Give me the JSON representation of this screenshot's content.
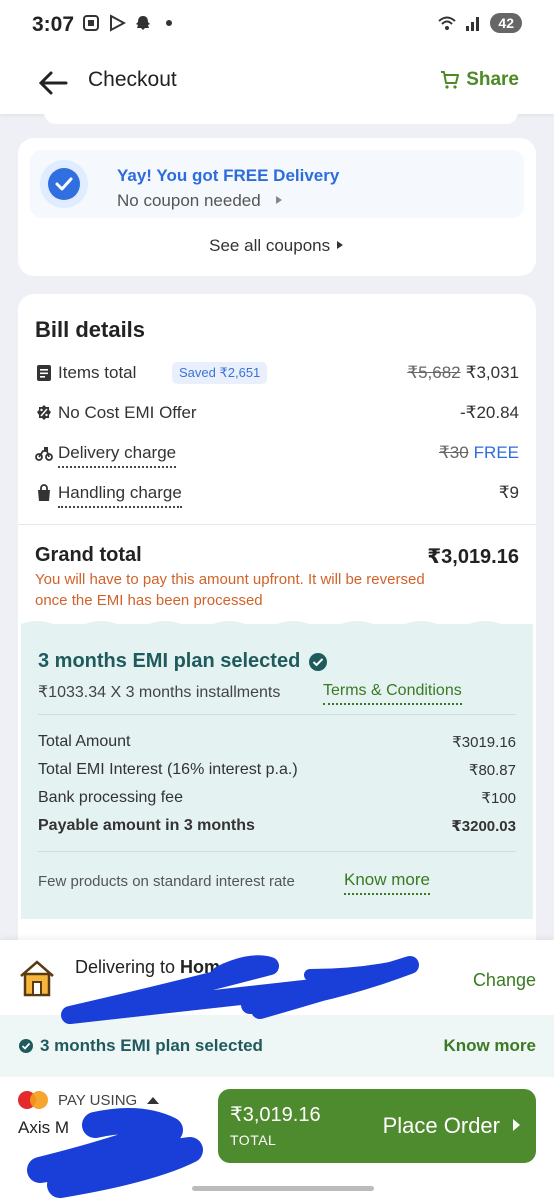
{
  "status": {
    "time": "3:07",
    "battery": "42"
  },
  "header": {
    "title": "Checkout",
    "share_label": "Share"
  },
  "coupon": {
    "title": "Yay! You got FREE Delivery",
    "subtitle": "No coupon needed",
    "see_all": "See all coupons"
  },
  "bill": {
    "title": "Bill details",
    "items_total": {
      "label": "Items total",
      "badge": "Saved ₹2,651",
      "original": "₹5,682",
      "value": "₹3,031"
    },
    "emi_offer": {
      "label": "No Cost EMI Offer",
      "value": "-₹20.84"
    },
    "delivery": {
      "label": "Delivery charge",
      "original": "₹30",
      "value": "FREE"
    },
    "handling": {
      "label": "Handling charge",
      "value": "₹9"
    },
    "grand_total": {
      "label": "Grand total",
      "value": "₹3,019.16",
      "note": "You will have to pay this amount upfront. It will be reversed once the EMI has been processed"
    }
  },
  "emi": {
    "title": "3 months EMI plan selected",
    "installments": "₹1033.34 X 3 months installments",
    "terms": "Terms & Conditions",
    "rows": [
      {
        "label": "Total Amount",
        "value": "₹3019.16"
      },
      {
        "label": "Total EMI Interest (16% interest p.a.)",
        "value": "₹80.87"
      },
      {
        "label": "Bank processing fee",
        "value": "₹100"
      },
      {
        "label": "Payable amount in 3 months",
        "value": "₹3200.03"
      }
    ],
    "footnote": "Few products on standard interest rate",
    "know_more": "Know more"
  },
  "bottom": {
    "delivering_prefix": "Delivering to ",
    "delivering_place": "Home",
    "change": "Change",
    "emi_strip": "3 months EMI plan selected",
    "emi_know_more": "Know more",
    "pay_using": "PAY USING",
    "bank": "Axis M",
    "price": "₹3,019.16",
    "total_label": "TOTAL",
    "place_order": "Place Order"
  },
  "colors": {
    "accent_green": "#4e8a2e",
    "link_blue": "#2d6ddb",
    "note_orange": "#d2622a",
    "emi_bg": "#e4f2f1",
    "redaction": "#1a3fd8"
  },
  "icons": [
    "back-arrow-icon",
    "cart-icon",
    "check-circle-icon",
    "chevron-right-icon",
    "receipt-icon",
    "discount-icon",
    "scooter-icon",
    "bag-icon",
    "verified-icon",
    "home-icon",
    "mastercard-icon",
    "caret-up-icon"
  ]
}
